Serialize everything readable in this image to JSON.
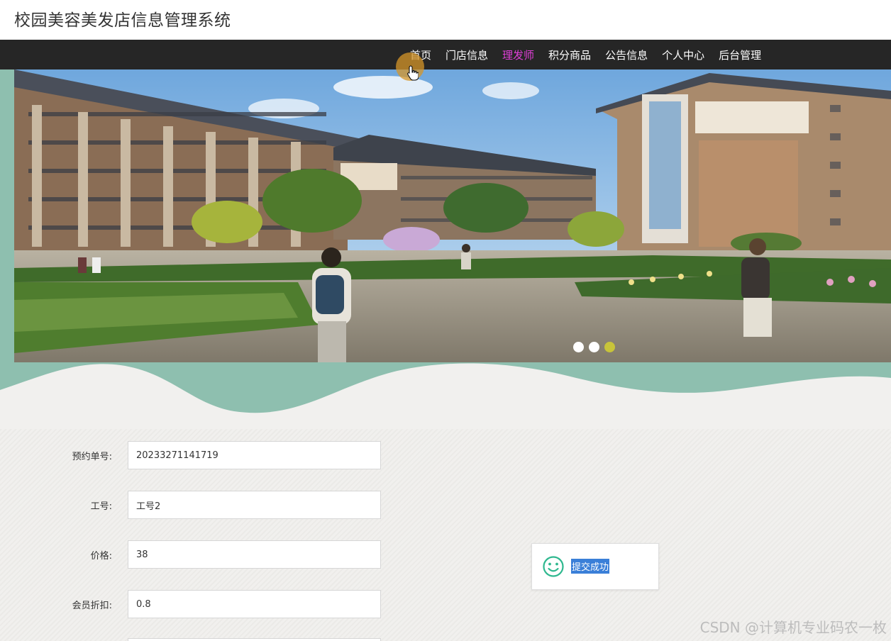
{
  "header": {
    "site_title": "校园美容美发店信息管理系统"
  },
  "nav": {
    "items": [
      {
        "label": "首页",
        "active": false
      },
      {
        "label": "门店信息",
        "active": false
      },
      {
        "label": "理发师",
        "active": true
      },
      {
        "label": "积分商品",
        "active": false
      },
      {
        "label": "公告信息",
        "active": false
      },
      {
        "label": "个人中心",
        "active": false
      },
      {
        "label": "后台管理",
        "active": false
      }
    ],
    "active_color": "#e040d8"
  },
  "banner": {
    "image": "campus-buildings-illustration",
    "slide_count": 3,
    "active_slide": 3
  },
  "form": {
    "fields": [
      {
        "label": "预约单号:",
        "value": "20233271141719"
      },
      {
        "label": "工号:",
        "value": "工号2"
      },
      {
        "label": "价格:",
        "value": "38"
      },
      {
        "label": "会员折扣:",
        "value": "0.8"
      }
    ]
  },
  "toast": {
    "icon": "smile-icon",
    "message": "提交成功"
  },
  "watermark": {
    "text": "CSDN @计算机专业码农一枚"
  },
  "colors": {
    "navbar": "#262626",
    "teal": "#8ebfaf",
    "toast_icon": "#2fb88f"
  }
}
